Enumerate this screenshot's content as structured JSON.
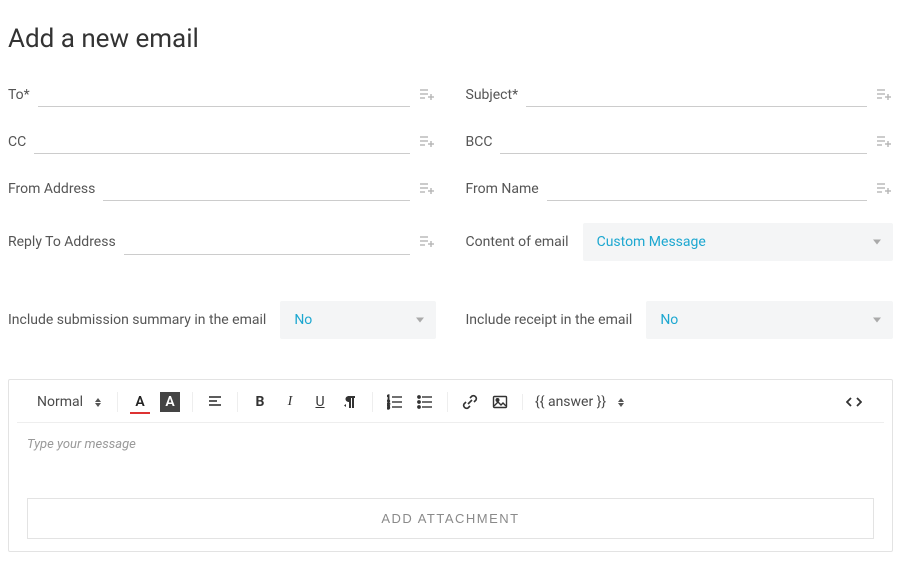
{
  "title": "Add a new email",
  "fields": {
    "to_label": "To*",
    "subject_label": "Subject*",
    "cc_label": "CC",
    "bcc_label": "BCC",
    "from_address_label": "From Address",
    "from_name_label": "From Name",
    "reply_to_label": "Reply To Address",
    "content_label": "Content of email",
    "content_value": "Custom Message",
    "include_summary_label": "Include submission summary in the email",
    "include_summary_value": "No",
    "include_receipt_label": "Include receipt in the email",
    "include_receipt_value": "No"
  },
  "toolbar": {
    "format_label": "Normal",
    "answer_token": "{{ answer }}"
  },
  "editor": {
    "placeholder": "Type your message"
  },
  "attach_button": "ADD ATTACHMENT"
}
